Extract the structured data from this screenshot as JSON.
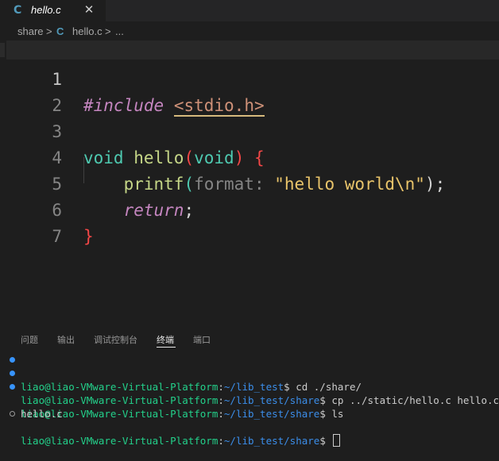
{
  "tab": {
    "icon": "c-file-icon",
    "label": "hello.c",
    "close": "✕"
  },
  "breadcrumb": {
    "folder": "share",
    "sep": ">",
    "file": "hello.c",
    "more": "..."
  },
  "editor": {
    "line_numbers": [
      "1",
      "2",
      "3",
      "4",
      "5",
      "6",
      "7"
    ],
    "line1": {
      "include": "#include",
      "header": "<stdio.h>"
    },
    "line3": {
      "ret_type": "void",
      "name": "hello",
      "open": "(",
      "param": "void",
      "close": ")",
      "brace": "{"
    },
    "line4": {
      "fn": "printf",
      "open": "(",
      "hint": "format:",
      "string": "\"hello world\\n\"",
      "close": ");"
    },
    "line5": {
      "kw": "return",
      "semi": ";"
    },
    "line6": {
      "brace": "}"
    }
  },
  "panel": {
    "tabs": [
      "问题",
      "输出",
      "调试控制台",
      "终端",
      "端口"
    ],
    "active_tab": "终端"
  },
  "terminal": {
    "lines": [
      {
        "user": "liao@liao-VMware-Virtual-Platform",
        "path": "~/lib_test",
        "cmd": "$ cd ./share/"
      },
      {
        "user": "liao@liao-VMware-Virtual-Platform",
        "path": "~/lib_test/share",
        "cmd": "$ cp ../static/hello.c hello.c"
      },
      {
        "user": "liao@liao-VMware-Virtual-Platform",
        "path": "~/lib_test/share",
        "cmd": "$ ls"
      },
      {
        "output": "hello.c"
      },
      {
        "user": "liao@liao-VMware-Virtual-Platform",
        "path": "~/lib_test/share",
        "cmd": "$ "
      }
    ],
    "colors": {
      "user": "#23d18b",
      "path": "#3b8eea"
    }
  }
}
